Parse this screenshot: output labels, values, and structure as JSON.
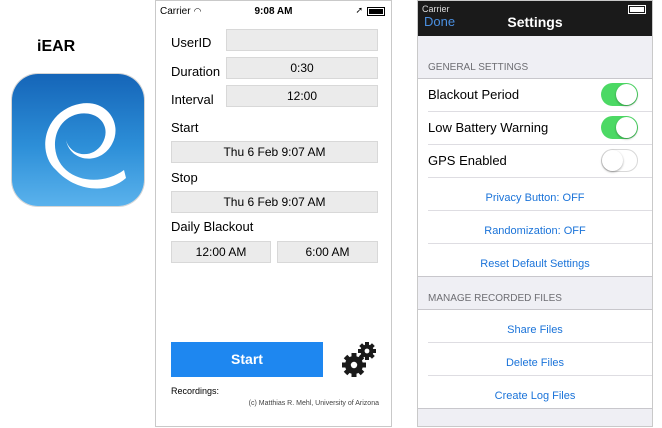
{
  "app": {
    "name": "iEAR",
    "icon": "iear-logo"
  },
  "phone1": {
    "status": {
      "carrier": "Carrier",
      "time": "9:08 AM"
    },
    "form": {
      "userid_label": "UserID",
      "userid_value": "",
      "duration_label": "Duration",
      "duration_value": "0:30",
      "interval_label": "Interval",
      "interval_value": "12:00",
      "start_label": "Start",
      "start_value": "Thu 6 Feb 9:07 AM",
      "stop_label": "Stop",
      "stop_value": "Thu 6 Feb 9:07 AM",
      "blackout_label": "Daily Blackout",
      "blackout_from": "12:00 AM",
      "blackout_to": "6:00 AM"
    },
    "start_button": "Start",
    "settings_icon": "gears-icon",
    "recordings_label": "Recordings:",
    "copyright": "(c) Matthias R. Mehl, University of Arizona"
  },
  "phone2": {
    "status": {
      "carrier": "Carrier"
    },
    "nav": {
      "done": "Done",
      "title": "Settings"
    },
    "general_header": "GENERAL SETTINGS",
    "general": [
      {
        "label": "Blackout Period",
        "on": true
      },
      {
        "label": "Low Battery Warning",
        "on": true
      },
      {
        "label": "GPS Enabled",
        "on": false
      }
    ],
    "general_links": [
      "Privacy Button: OFF",
      "Randomization: OFF",
      "Reset Default Settings"
    ],
    "files_header": "MANAGE RECORDED FILES",
    "files_links": [
      "Share Files",
      "Delete Files",
      "Create Log Files"
    ],
    "colors": {
      "accent": "#1e87f0",
      "switch_on": "#4cd964",
      "link": "#1a73d9"
    }
  }
}
